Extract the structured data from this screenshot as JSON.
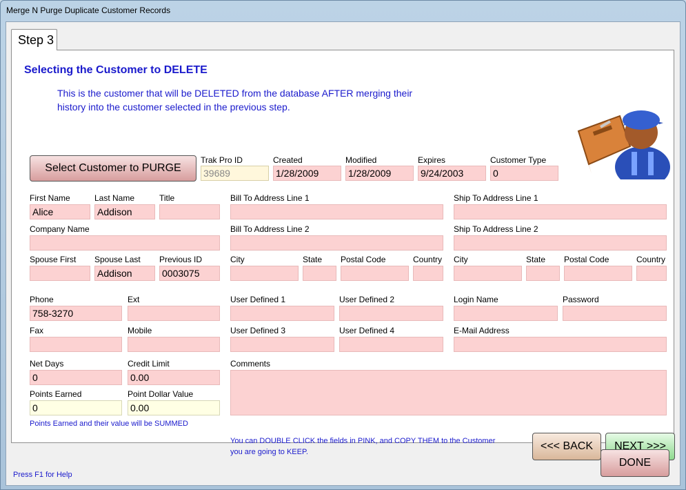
{
  "window": {
    "title": "Merge N Purge Duplicate Customer Records"
  },
  "tab": {
    "label": "Step 3"
  },
  "header": {
    "title": "Selecting the Customer to DELETE",
    "description": "This is the customer that will be DELETED from the database AFTER merging their history into the customer selected in the previous step."
  },
  "select_button": "Select Customer to PURGE",
  "fields": {
    "trakpro_id": {
      "label": "Trak Pro ID",
      "value": "39689"
    },
    "created": {
      "label": "Created",
      "value": "1/28/2009"
    },
    "modified": {
      "label": "Modified",
      "value": "1/28/2009"
    },
    "expires": {
      "label": "Expires",
      "value": "9/24/2003"
    },
    "customer_type": {
      "label": "Customer Type",
      "value": "0"
    },
    "first_name": {
      "label": "First Name",
      "value": "Alice"
    },
    "last_name": {
      "label": "Last Name",
      "value": "Addison"
    },
    "title": {
      "label": "Title",
      "value": ""
    },
    "company_name": {
      "label": "Company Name",
      "value": ""
    },
    "spouse_first": {
      "label": "Spouse First",
      "value": ""
    },
    "spouse_last": {
      "label": "Spouse Last",
      "value": "Addison"
    },
    "previous_id": {
      "label": "Previous ID",
      "value": "0003075"
    },
    "bill_line1": {
      "label": "Bill To Address Line 1",
      "value": ""
    },
    "bill_line2": {
      "label": "Bill To Address Line 2",
      "value": ""
    },
    "bill_city": {
      "label": "City",
      "value": ""
    },
    "bill_state": {
      "label": "State",
      "value": ""
    },
    "bill_postal": {
      "label": "Postal Code",
      "value": ""
    },
    "bill_country": {
      "label": "Country",
      "value": ""
    },
    "ship_line1": {
      "label": "Ship To Address Line 1",
      "value": ""
    },
    "ship_line2": {
      "label": "Ship To Address Line 2",
      "value": ""
    },
    "ship_city": {
      "label": "City",
      "value": ""
    },
    "ship_state": {
      "label": "State",
      "value": ""
    },
    "ship_postal": {
      "label": "Postal Code",
      "value": ""
    },
    "ship_country": {
      "label": "Country",
      "value": ""
    },
    "phone": {
      "label": "Phone",
      "value": "758-3270"
    },
    "ext": {
      "label": "Ext",
      "value": ""
    },
    "fax": {
      "label": "Fax",
      "value": ""
    },
    "mobile": {
      "label": "Mobile",
      "value": ""
    },
    "user_defined1": {
      "label": "User Defined 1",
      "value": ""
    },
    "user_defined2": {
      "label": "User Defined 2",
      "value": ""
    },
    "user_defined3": {
      "label": "User Defined 3",
      "value": ""
    },
    "user_defined4": {
      "label": "User Defined 4",
      "value": ""
    },
    "login_name": {
      "label": "Login Name",
      "value": ""
    },
    "password": {
      "label": "Password",
      "value": ""
    },
    "email": {
      "label": "E-Mail Address",
      "value": ""
    },
    "net_days": {
      "label": "Net Days",
      "value": "0"
    },
    "credit_limit": {
      "label": "Credit Limit",
      "value": "0.00"
    },
    "points_earned": {
      "label": "Points Earned",
      "value": "0"
    },
    "point_dollar_value": {
      "label": "Point Dollar Value",
      "value": "0.00"
    },
    "comments": {
      "label": "Comments",
      "value": ""
    }
  },
  "notes": {
    "points_summed": "Points Earned and their value will be SUMMED",
    "double_click": "You can DOUBLE CLICK the fields in PINK, and COPY THEM to the Customer you are going to KEEP."
  },
  "buttons": {
    "back": "<<< BACK",
    "next": "NEXT >>>",
    "done": "DONE"
  },
  "footer": {
    "help": "Press F1 for Help"
  },
  "icons": {
    "mascot": "worker-with-toolbox-icon"
  },
  "colors": {
    "field_pink": "#fcd2d2",
    "field_yellow": "#ffffe4",
    "heading_blue": "#1a1acc"
  }
}
